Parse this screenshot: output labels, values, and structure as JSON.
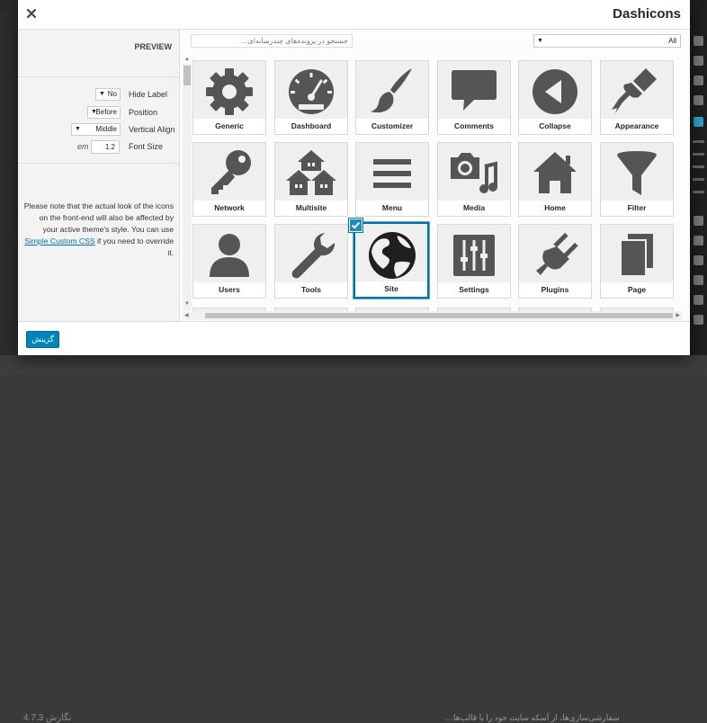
{
  "modal": {
    "title": "Dashicons",
    "close_icon": "close-icon"
  },
  "preview": {
    "title": "PREVIEW"
  },
  "options": {
    "hide_label": {
      "label": "Hide Label",
      "value": "No"
    },
    "position": {
      "label": "Position",
      "value": "Before"
    },
    "vertical_align": {
      "label": "Vertical Align",
      "value": "Middle"
    },
    "font_size": {
      "label": "Font Size",
      "unit": "em",
      "value": "1.2"
    }
  },
  "note": {
    "text": "Please note that the actual look of the icons on the front-end will also be affected by your active theme's style. You can use ",
    "link": "Simple Custom CSS",
    "text_after": " if you need to override it."
  },
  "search": {
    "placeholder": "جستجو در پرونده‌های چندرسانه‌ای..."
  },
  "filter": {
    "value": "All"
  },
  "icons": [
    {
      "label": "Generic",
      "icon": "gear-icon"
    },
    {
      "label": "Dashboard",
      "icon": "dashboard-gauge-icon"
    },
    {
      "label": "Customizer",
      "icon": "paintbrush-icon"
    },
    {
      "label": "Comments",
      "icon": "speech-bubble-icon"
    },
    {
      "label": "Collapse",
      "icon": "collapse-circle-icon"
    },
    {
      "label": "Appearance",
      "icon": "appearance-brush-icon"
    },
    {
      "label": "Network",
      "icon": "key-icon"
    },
    {
      "label": "Multisite",
      "icon": "multisite-houses-icon"
    },
    {
      "label": "Menu",
      "icon": "menu-lines-icon"
    },
    {
      "label": "Media",
      "icon": "camera-music-icon"
    },
    {
      "label": "Home",
      "icon": "home-icon"
    },
    {
      "label": "Filter",
      "icon": "funnel-icon"
    },
    {
      "label": "Users",
      "icon": "user-icon"
    },
    {
      "label": "Tools",
      "icon": "wrench-icon"
    },
    {
      "label": "Site",
      "icon": "globe-icon"
    },
    {
      "label": "Settings",
      "icon": "sliders-icon"
    },
    {
      "label": "Plugins",
      "icon": "plug-icon"
    },
    {
      "label": "Page",
      "icon": "pages-icon"
    }
  ],
  "selected_icon": "Site",
  "footer": {
    "insert_label": "گزینش"
  },
  "background": {
    "version": "نگارش 4.7.3",
    "note": "سفارشی‌سازی‌ها، از آسکه سایت خود را با قالب‌ها…"
  },
  "colors": {
    "accent": "#0073aa",
    "button": "#0085ba",
    "icon": "#555555"
  }
}
